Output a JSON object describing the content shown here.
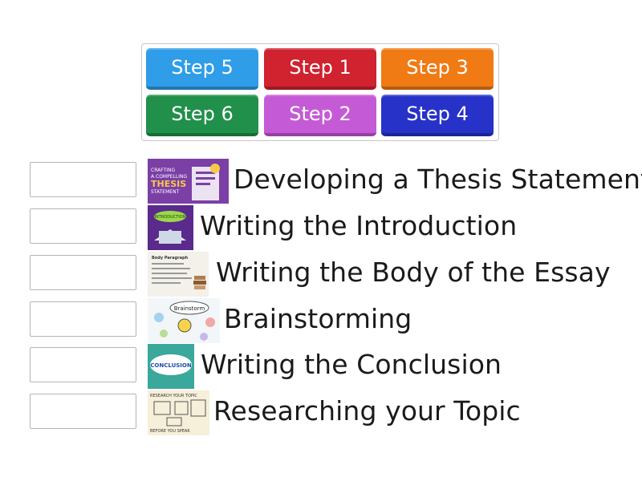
{
  "tiles": [
    {
      "label": "Step 5",
      "color": "#2f9de8"
    },
    {
      "label": "Step 1",
      "color": "#d0222f"
    },
    {
      "label": "Step 3",
      "color": "#f07a14"
    },
    {
      "label": "Step 6",
      "color": "#21904a"
    },
    {
      "label": "Step 2",
      "color": "#c55ad6"
    },
    {
      "label": "Step 4",
      "color": "#2632c8"
    }
  ],
  "rows": [
    {
      "label": "Developing a Thesis Statement",
      "image_icon": "thesis-image",
      "image_text": [
        "CRAFTING",
        "A COMPELLING",
        "THESIS",
        "STATEMENT"
      ]
    },
    {
      "label": "Writing the Introduction",
      "image_icon": "introduction-image",
      "image_text": [
        "INTRODUCTION"
      ]
    },
    {
      "label": "Writing the Body of the Essay",
      "image_icon": "body-paragraph-image",
      "image_text": [
        "Body Paragraph"
      ]
    },
    {
      "label": "Brainstorming",
      "image_icon": "brainstorm-image",
      "image_text": [
        "Brainstorm"
      ]
    },
    {
      "label": "Writing the Conclusion",
      "image_icon": "conclusion-image",
      "image_text": [
        "CONCLUSION"
      ]
    },
    {
      "label": "Researching your Topic",
      "image_icon": "research-image",
      "image_text": [
        "RESEARCH YOUR TOPIC",
        "BEFORE YOU SPEAK"
      ]
    }
  ]
}
